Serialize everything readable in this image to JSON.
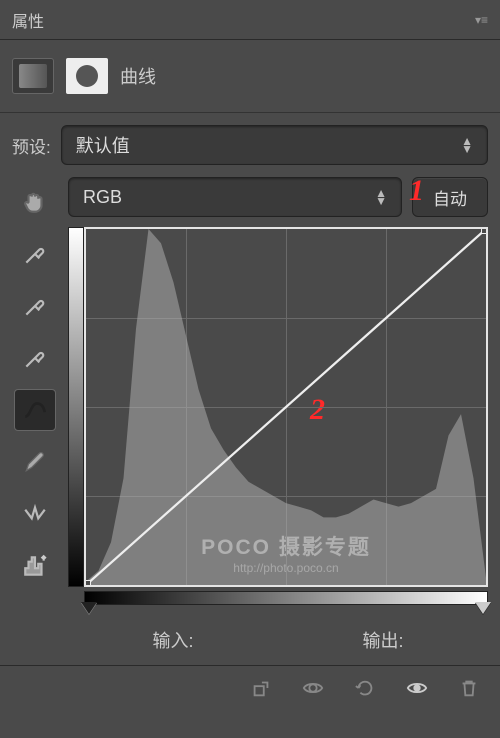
{
  "panel": {
    "title": "属性"
  },
  "adjustment": {
    "type": "曲线"
  },
  "preset": {
    "label": "预设:",
    "value": "默认值"
  },
  "channel": {
    "value": "RGB"
  },
  "autoButton": {
    "label": "自动"
  },
  "io": {
    "input_label": "输入:",
    "output_label": "输出:"
  },
  "annotations": {
    "one": "1",
    "two": "2"
  },
  "watermark": {
    "main": "POCO 摄影专题",
    "sub": "http://photo.poco.cn"
  },
  "chart_data": {
    "type": "line",
    "title": "",
    "xlabel": "输入",
    "ylabel": "输出",
    "xlim": [
      0,
      255
    ],
    "ylim": [
      0,
      255
    ],
    "series": [
      {
        "name": "curve",
        "x": [
          0,
          255
        ],
        "y": [
          0,
          255
        ]
      }
    ],
    "histogram": {
      "x_step": 8,
      "values_pct": [
        1,
        4,
        12,
        30,
        72,
        100,
        96,
        85,
        70,
        55,
        44,
        38,
        33,
        29,
        27,
        25,
        23,
        22,
        21,
        19,
        19,
        20,
        22,
        24,
        23,
        22,
        23,
        25,
        27,
        42,
        48,
        30,
        2
      ]
    },
    "grid": {
      "x_divisions": 4,
      "y_divisions": 4
    }
  }
}
